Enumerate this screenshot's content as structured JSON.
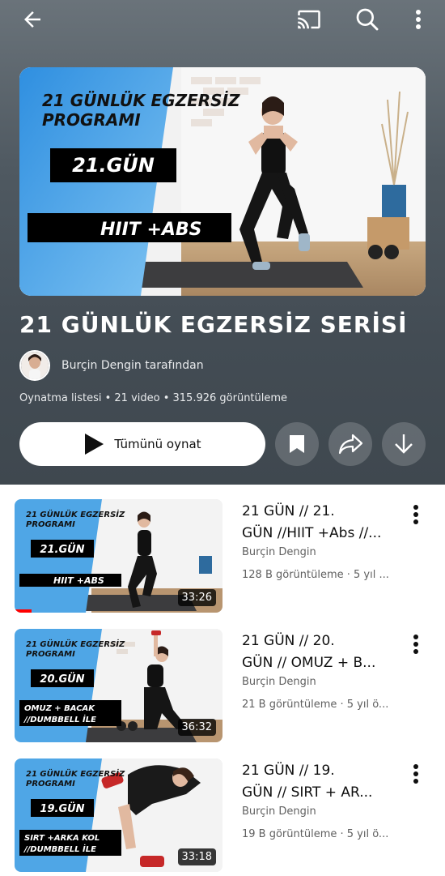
{
  "topbar": {
    "back_icon": "arrow-back-icon",
    "cast_icon": "cast-icon",
    "search_icon": "search-icon",
    "more_icon": "more-vert-icon"
  },
  "playlist": {
    "title": "21 GÜNLÜK EGZERSİZ SERİSİ",
    "owner": "Burçin Dengin tarafından",
    "meta": "Oynatma listesi • 21 video • 315.926 görüntüleme",
    "play_all_label": "Tümünü oynat",
    "hero": {
      "heading_line1": "21 GÜNLÜK EGZERSİZ",
      "heading_line2": "PROGRAMI",
      "day": "21.GÜN",
      "tag": "HIIT +ABS"
    }
  },
  "videos": [
    {
      "title": "21 GÜN // 21.\nGÜN //HIIT +Abs //...",
      "channel": "Burçin Dengin",
      "meta": "128 B görüntüleme · 5 yıl ...",
      "duration": "33:26",
      "progress": 0.08,
      "thumb_heading1": "21 GÜNLÜK EGZERSİZ",
      "thumb_heading2": "PROGRAMI",
      "thumb_day": "21.GÜN",
      "thumb_tag1": "HIIT +ABS",
      "thumb_tag2": ""
    },
    {
      "title": "21 GÜN // 20.\nGÜN // OMUZ + B...",
      "channel": "Burçin Dengin",
      "meta": "21 B görüntüleme · 5 yıl ö...",
      "duration": "36:32",
      "progress": 0,
      "thumb_heading1": "21 GÜNLÜK EGZERSİZ",
      "thumb_heading2": "PROGRAMI",
      "thumb_day": "20.GÜN",
      "thumb_tag1": "OMUZ + BACAK",
      "thumb_tag2": "//DUMBBELL İLE"
    },
    {
      "title": "21 GÜN // 19.\nGÜN // SIRT + AR...",
      "channel": "Burçin Dengin",
      "meta": "19 B görüntüleme · 5 yıl ö...",
      "duration": "33:18",
      "progress": 0,
      "thumb_heading1": "21 GÜNLÜK EGZERSİZ",
      "thumb_heading2": "PROGRAMI",
      "thumb_day": "19.GÜN",
      "thumb_tag1": "SIRT +ARKA KOL",
      "thumb_tag2": "//DUMBBELL İLE"
    }
  ],
  "colors": {
    "header_bg": "#4f5961",
    "thumb_blue": "#4fa6e6",
    "progress_red": "#ff0000"
  }
}
